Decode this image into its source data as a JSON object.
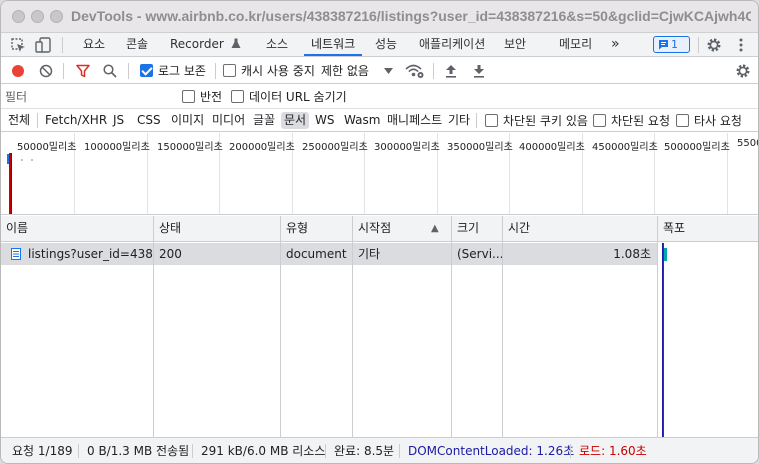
{
  "window": {
    "title": "DevTools - www.airbnb.co.kr/users/438387216/listings?user_id=438387216&s=50&gclid=CjwKCAjwh4O..."
  },
  "tabs": {
    "items": [
      "요소",
      "콘솔",
      "Recorder",
      "소스",
      "네트워크",
      "성능",
      "애플리케이션",
      "보안",
      "메모리"
    ],
    "more": "»",
    "issues_count": "1",
    "active": "네트워크"
  },
  "toolbar": {
    "preserve_log_label": "로그 보존",
    "preserve_log_checked": true,
    "disable_cache_label": "캐시 사용 중지",
    "disable_cache_checked": false,
    "throttling_value": "제한 없음"
  },
  "filter": {
    "placeholder": "필터",
    "invert_label": "반전",
    "hide_data_urls_label": "데이터 URL 숨기기"
  },
  "type_filters": {
    "items": [
      "전체",
      "Fetch/XHR",
      "JS",
      "CSS",
      "이미지",
      "미디어",
      "글꼴",
      "문서",
      "WS",
      "Wasm",
      "매니페스트",
      "기타"
    ],
    "active": "문서",
    "blocked_cookies_label": "차단된 쿠키 있음",
    "blocked_requests_label": "차단된 요청",
    "third_party_label": "타사 요청"
  },
  "overview": {
    "ticks": [
      "50000밀리초",
      "100000밀리초",
      "150000밀리초",
      "200000밀리초",
      "250000밀리초",
      "300000밀리초",
      "350000밀리초",
      "400000밀리초",
      "450000밀리초",
      "500000밀리초",
      "5500"
    ]
  },
  "table": {
    "columns": [
      "이름",
      "상태",
      "유형",
      "시작점",
      "크기",
      "시간",
      "폭포"
    ],
    "sort_indicator": "▲",
    "rows": [
      {
        "name": "listings?user_id=438...",
        "status": "200",
        "type": "document",
        "initiator": "기타",
        "size": "(Servi...",
        "time": "1.08초"
      }
    ]
  },
  "status": {
    "requests": "요청 1/189",
    "transferred": "0 B/1.3 MB 전송됨",
    "resources": "291 kB/6.0 MB 리소스",
    "finish": "완료: 8.5분",
    "dom_content_loaded": "DOMContentLoaded: 1.26초",
    "load": "로드: 1.60초"
  },
  "colors": {
    "accent": "#1a73e8",
    "record": "#ea4335",
    "dom_content_loaded": "#1a1aa6",
    "load": "#c80000",
    "filter_active": "#d93025"
  }
}
